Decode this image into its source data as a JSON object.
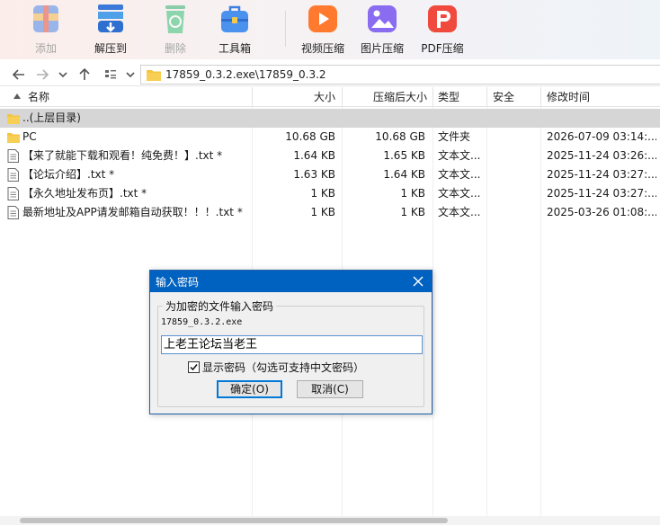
{
  "toolbar": {
    "items": [
      {
        "label": "添加",
        "icon": "add-archive-icon",
        "enabled": false
      },
      {
        "label": "解压到",
        "icon": "extract-icon",
        "enabled": true
      },
      {
        "label": "删除",
        "icon": "recycle-bin-icon",
        "enabled": false
      },
      {
        "label": "工具箱",
        "icon": "toolbox-icon",
        "enabled": true
      },
      {
        "label": "视频压缩",
        "icon": "video-compress-icon",
        "enabled": true
      },
      {
        "label": "图片压缩",
        "icon": "image-compress-icon",
        "enabled": true
      },
      {
        "label": "PDF压缩",
        "icon": "pdf-compress-icon",
        "enabled": true
      }
    ]
  },
  "address": {
    "path": "17859_0.3.2.exe\\17859_0.3.2"
  },
  "columns": {
    "name": "名称",
    "size": "大小",
    "packed": "压缩后大小",
    "type": "类型",
    "security": "安全",
    "modified": "修改时间"
  },
  "rows": [
    {
      "name": "..(上层目录)",
      "size": "",
      "packed": "",
      "type": "",
      "modified": "",
      "icon": "folder-icon"
    },
    {
      "name": "PC",
      "size": "10.68 GB",
      "packed": "10.68 GB",
      "type": "文件夹",
      "modified": "2026-07-09 03:14:...",
      "icon": "folder-icon"
    },
    {
      "name": "【来了就能下载和观看！纯免费！】.txt *",
      "size": "1.64 KB",
      "packed": "1.65 KB",
      "type": "文本文...",
      "modified": "2025-11-24 03:26:...",
      "icon": "text-file-icon"
    },
    {
      "name": "【论坛介绍】.txt *",
      "size": "1.63 KB",
      "packed": "1.64 KB",
      "type": "文本文...",
      "modified": "2025-11-24 03:27:...",
      "icon": "text-file-icon"
    },
    {
      "name": "【永久地址发布页】.txt *",
      "size": "1 KB",
      "packed": "1 KB",
      "type": "文本文...",
      "modified": "2025-11-24 03:27:...",
      "icon": "text-file-icon"
    },
    {
      "name": "最新地址及APP请发邮箱自动获取！！！.txt *",
      "size": "1 KB",
      "packed": "1 KB",
      "type": "文本文...",
      "modified": "2025-03-26 01:08:...",
      "icon": "text-file-icon"
    }
  ],
  "dialog": {
    "title": "输入密码",
    "group_label": "为加密的文件输入密码",
    "filename": "17859_0.3.2.exe",
    "password": "上老王论坛当老王",
    "show_password_label": "显示密码（勾选可支持中文密码）",
    "show_password_checked": true,
    "ok_label": "确定(O)",
    "cancel_label": "取消(C)"
  },
  "colors": {
    "dialog_title_bar": "#0062c0",
    "parent_row_highlight": "#d6d6d6",
    "folder": "#f4c542"
  }
}
